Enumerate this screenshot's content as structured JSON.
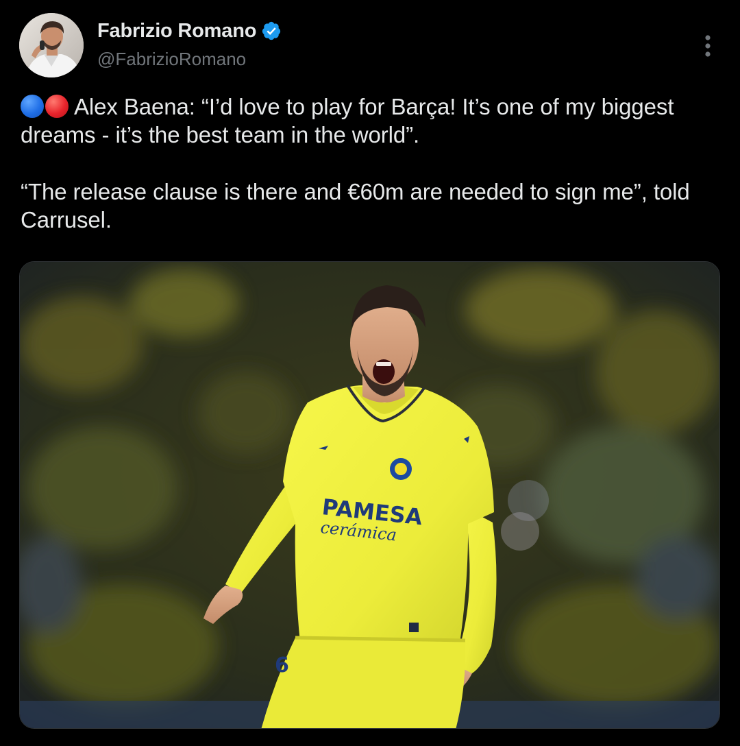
{
  "author": {
    "display_name": "Fabrizio Romano",
    "handle": "@FabrizioRomano",
    "verified": true,
    "verified_color": "#1d9bf0"
  },
  "tweet": {
    "emojis": [
      "blue-circle",
      "red-circle"
    ],
    "emoji_colors": {
      "blue": "#1f6ee6",
      "red": "#e8232b"
    },
    "line1": "Alex Baena: “I’d love to play for Barça! It’s one of my biggest dreams - it’s the best team in the world”.",
    "line2": "“The release clause is there and €60m are needed to sign me”, told Carrusel."
  },
  "media": {
    "kind": "photo",
    "shirt_sponsor_line1": "PAMESA",
    "shirt_sponsor_line2": "cerámica",
    "shorts_number": "6",
    "shirt_color": "#efef3c"
  },
  "icons": {
    "more": "more-vertical-icon",
    "verified": "verified-badge-icon"
  },
  "colors": {
    "background": "#000000",
    "text_primary": "#e7e9ea",
    "text_secondary": "#71767b"
  }
}
